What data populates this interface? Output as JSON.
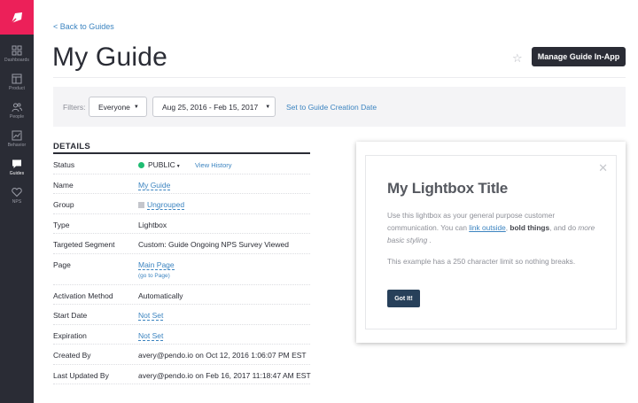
{
  "sidebar": {
    "items": [
      {
        "label": "Dashboards",
        "icon": "dashboard-icon"
      },
      {
        "label": "Product",
        "icon": "product-icon"
      },
      {
        "label": "People",
        "icon": "people-icon"
      },
      {
        "label": "Behavior",
        "icon": "behavior-icon"
      },
      {
        "label": "Guides",
        "icon": "guides-icon"
      },
      {
        "label": "NPS",
        "icon": "heart-icon"
      }
    ],
    "active": "Guides"
  },
  "header": {
    "back_link": "< Back to Guides",
    "title": "My Guide",
    "manage_button": "Manage Guide In-App"
  },
  "filters": {
    "label": "Filters:",
    "audience": "Everyone",
    "date_range": "Aug 25, 2016 - Feb 15, 2017",
    "creation_date_link": "Set to Guide Creation Date"
  },
  "details": {
    "heading": "DETAILS",
    "status": {
      "label": "Status",
      "value": "PUBLIC",
      "history_link": "View History"
    },
    "name": {
      "label": "Name",
      "value": "My Guide"
    },
    "group": {
      "label": "Group",
      "value": "Ungrouped"
    },
    "type": {
      "label": "Type",
      "value": "Lightbox"
    },
    "segment": {
      "label": "Targeted Segment",
      "value": "Custom: Guide Ongoing NPS Survey Viewed"
    },
    "page": {
      "label": "Page",
      "value": "Main Page",
      "sub_link": "(go to Page)"
    },
    "activation": {
      "label": "Activation Method",
      "value": "Automatically"
    },
    "start_date": {
      "label": "Start Date",
      "value": "Not Set"
    },
    "expiration": {
      "label": "Expiration",
      "value": "Not Set"
    },
    "created_by": {
      "label": "Created By",
      "value": "avery@pendo.io on Oct 12, 2016 1:06:07 PM EST"
    },
    "updated_by": {
      "label": "Last Updated By",
      "value": "avery@pendo.io on Feb 16, 2017 11:18:47 AM EST"
    }
  },
  "lightbox": {
    "title": "My Lightbox Title",
    "body_part1": "Use this lightbox as your general purpose customer communication. You can ",
    "body_link": "link outside",
    "body_part2": ", ",
    "body_bold": "bold things",
    "body_part3": ", and do ",
    "body_italic": "more basic styling",
    "body_part4": " .",
    "note": "This example has a 250 character limit so nothing breaks.",
    "button": "Got It!"
  },
  "colors": {
    "sidebar_bg": "#2a2c35",
    "logo_bg": "#ec2059",
    "link": "#3c84c0",
    "status_public": "#1fbc72",
    "lightbox_button": "#27405a"
  }
}
